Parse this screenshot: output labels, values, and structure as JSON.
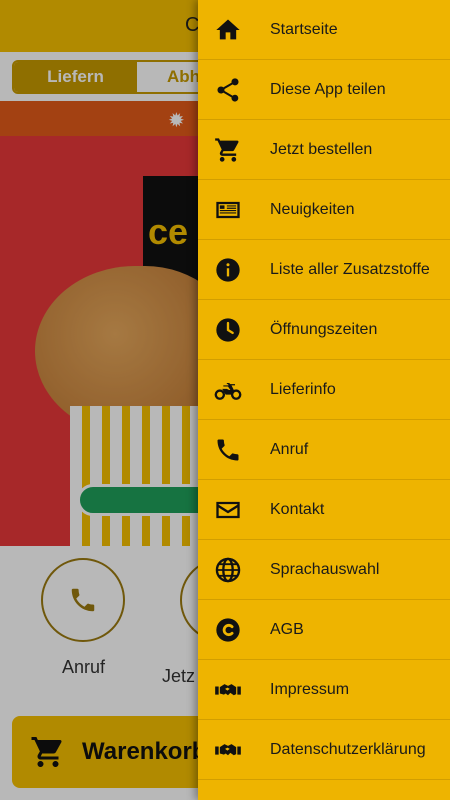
{
  "app": {
    "title": "C",
    "tabs": [
      "Liefern",
      "Abho"
    ],
    "hero_logo_text": "ce",
    "actions": [
      {
        "label": "Anruf",
        "icon": "phone-icon"
      },
      {
        "label": "Jetz",
        "icon": "cart-icon"
      }
    ],
    "cart_label": "Warenkorb"
  },
  "drawer": {
    "items": [
      {
        "label": "Startseite",
        "icon": "home-icon"
      },
      {
        "label": "Diese App teilen",
        "icon": "share-icon"
      },
      {
        "label": "Jetzt bestellen",
        "icon": "cart-icon"
      },
      {
        "label": "Neuigkeiten",
        "icon": "newspaper-icon"
      },
      {
        "label": "Liste aller Zusatzstoffe",
        "icon": "info-icon"
      },
      {
        "label": "Öffnungszeiten",
        "icon": "clock-icon"
      },
      {
        "label": "Lieferinfo",
        "icon": "motorcycle-icon"
      },
      {
        "label": "Anruf",
        "icon": "phone-icon"
      },
      {
        "label": "Kontakt",
        "icon": "envelope-icon"
      },
      {
        "label": "Sprachauswahl",
        "icon": "globe-icon"
      },
      {
        "label": "AGB",
        "icon": "copyright-icon"
      },
      {
        "label": "Impressum",
        "icon": "handshake-icon"
      },
      {
        "label": "Datenschutzerklärung",
        "icon": "handshake-icon"
      }
    ]
  },
  "colors": {
    "drawer_bg": "#eeb400",
    "accent": "#f5c000",
    "brand_brown": "#c79a00"
  }
}
